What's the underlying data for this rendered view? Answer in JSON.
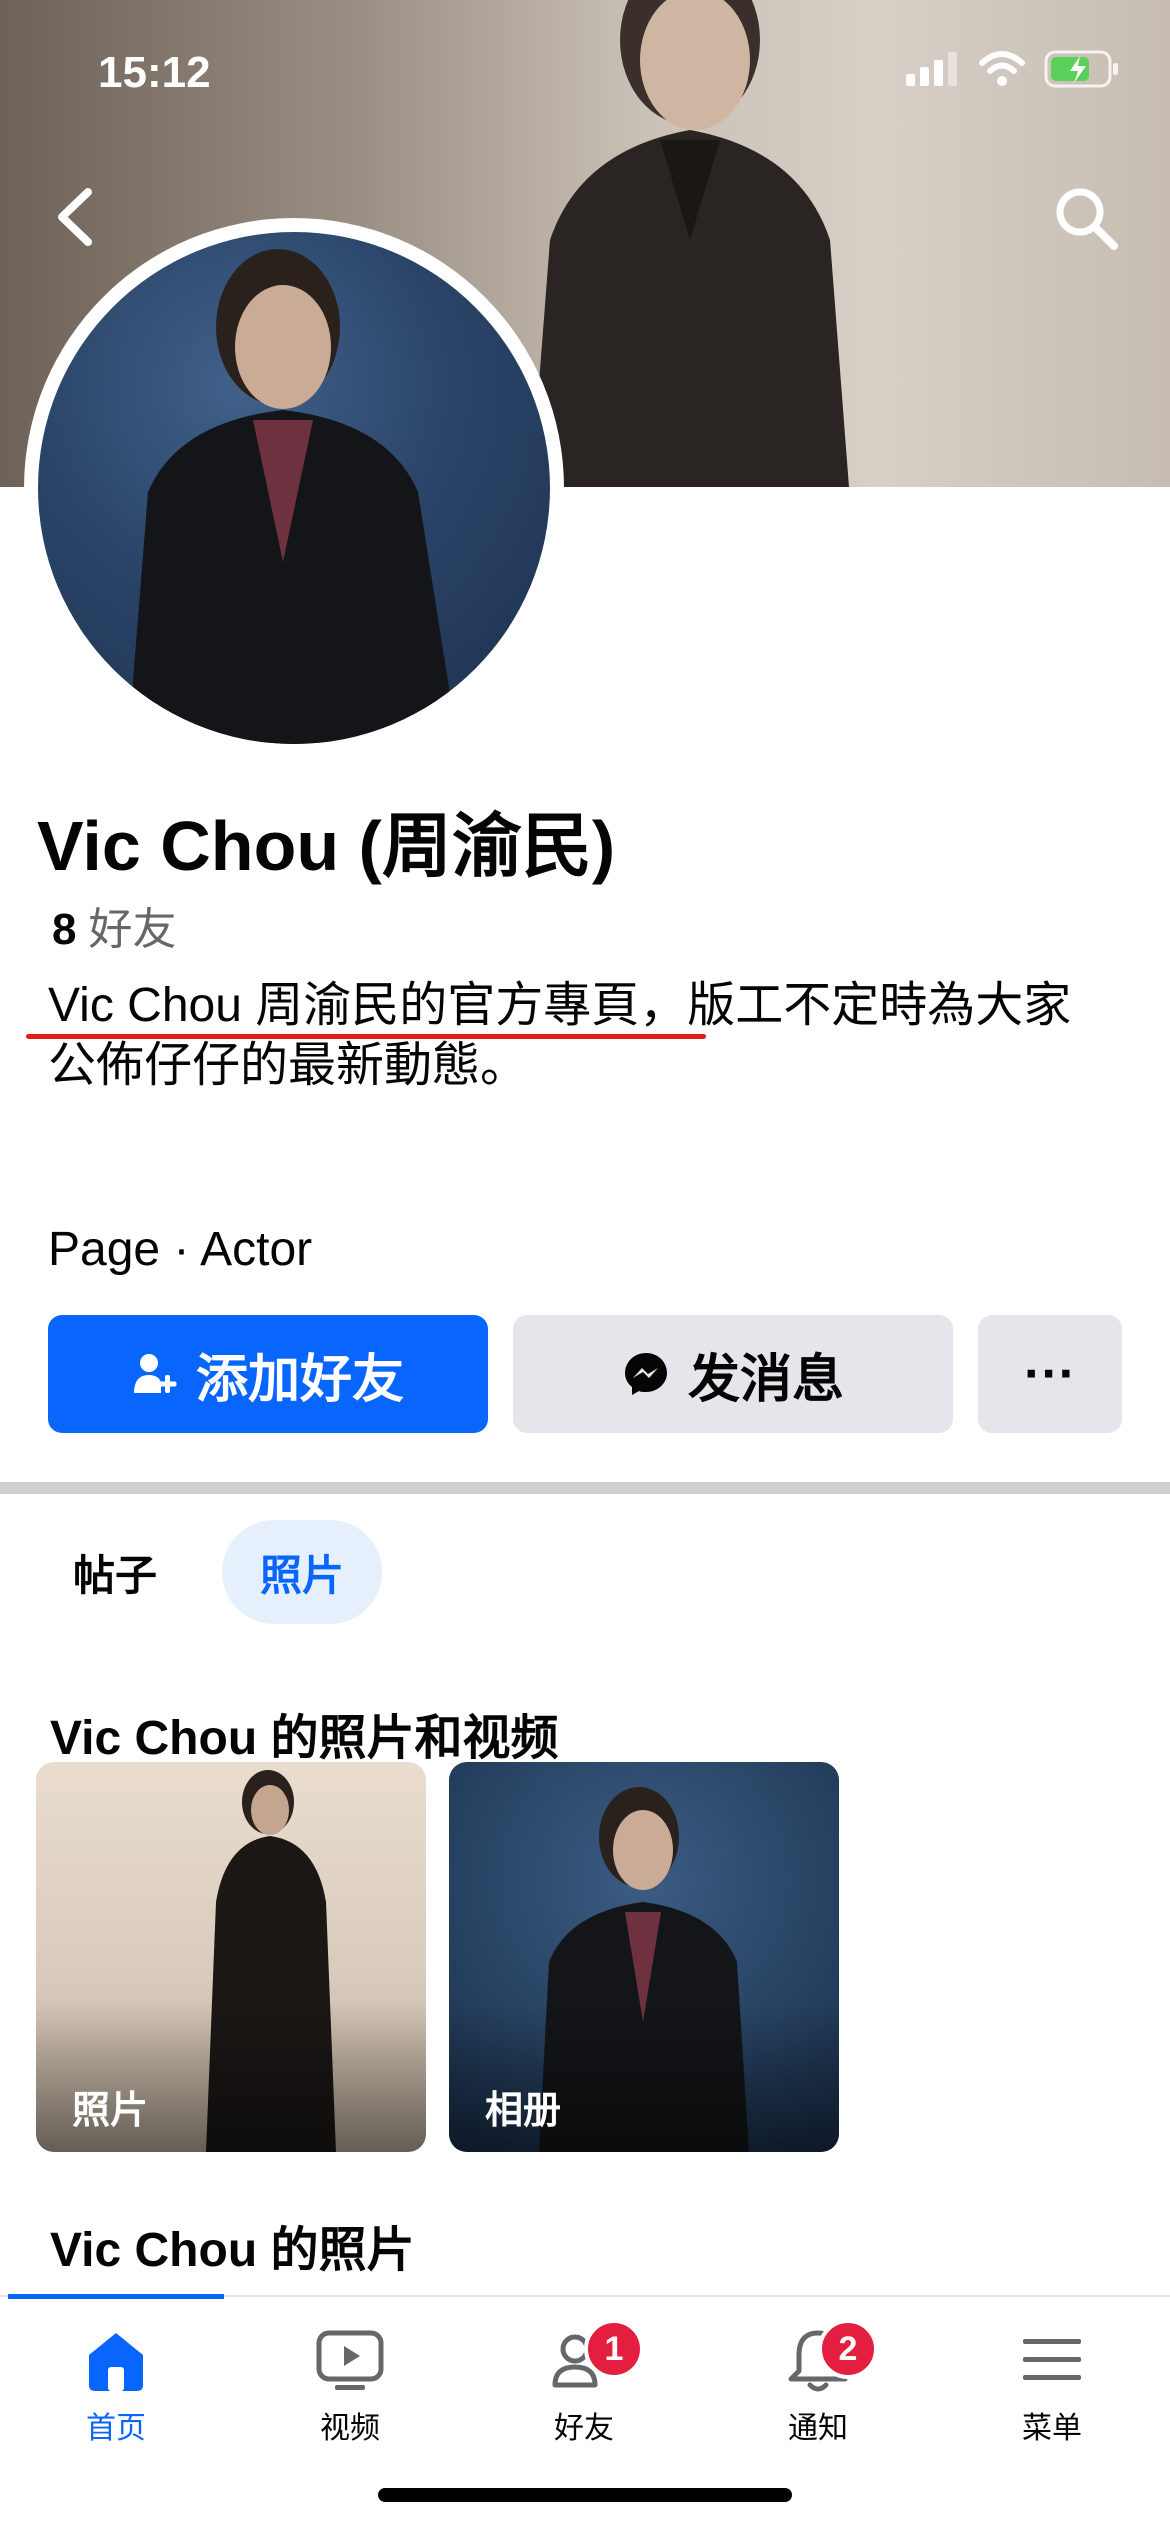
{
  "status_bar": {
    "time": "15:12"
  },
  "profile": {
    "name": "Vic Chou (周渝民)",
    "friends_count": "8",
    "friends_label": "好友",
    "bio": "Vic Chou 周渝民的官方專頁，版工不定時為大家公佈仔仔的最新動態。",
    "category": "Page · Actor"
  },
  "actions": {
    "add_friend": "添加好友",
    "message": "发消息",
    "more": "···"
  },
  "tabs": [
    {
      "label": "帖子",
      "active": false
    },
    {
      "label": "照片",
      "active": true
    }
  ],
  "sections": {
    "photos_videos_title": "Vic Chou 的照片和视频",
    "photos_title": "Vic Chou 的照片"
  },
  "thumbnails": [
    {
      "label": "照片"
    },
    {
      "label": "相册"
    }
  ],
  "bottom_nav": [
    {
      "label": "首页",
      "icon": "home-icon",
      "active": true
    },
    {
      "label": "视频",
      "icon": "video-icon",
      "active": false
    },
    {
      "label": "好友",
      "icon": "friends-icon",
      "active": false,
      "badge": "1"
    },
    {
      "label": "通知",
      "icon": "bell-icon",
      "active": false,
      "badge": "2"
    },
    {
      "label": "菜单",
      "icon": "menu-icon",
      "active": false
    }
  ],
  "colors": {
    "accent": "#0866ff",
    "badge": "#e41e3f",
    "underline": "#e11a1a"
  }
}
